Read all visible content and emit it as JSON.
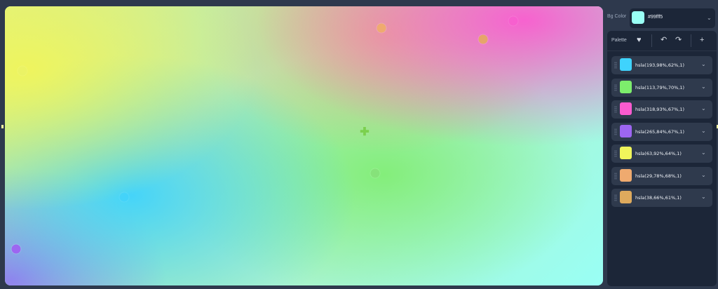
{
  "background": {
    "label": "Bg Color",
    "value": "#99fff5",
    "color": "#99fff5"
  },
  "toolbar": {
    "palette_label": "Palette",
    "icons": [
      "heart-icon",
      "undo-icon",
      "redo-icon",
      "plus-icon"
    ]
  },
  "palette": [
    {
      "label": "hsla(193,98%,62%,1)",
      "color": "#3fd3fd"
    },
    {
      "label": "hsla(113,79%,70%,1)",
      "color": "#7ded6c"
    },
    {
      "label": "hsla(318,93%,67%,1)",
      "color": "#fa5bd0"
    },
    {
      "label": "hsla(265,84%,67%,1)",
      "color": "#9d66f1"
    },
    {
      "label": "hsla(63,92%,64%,1)",
      "color": "#f0f55b"
    },
    {
      "label": "hsla(29,78%,68%,1)",
      "color": "#efaa6f"
    },
    {
      "label": "hsla(38,66%,61%,1)",
      "color": "#deaa5d"
    }
  ]
}
